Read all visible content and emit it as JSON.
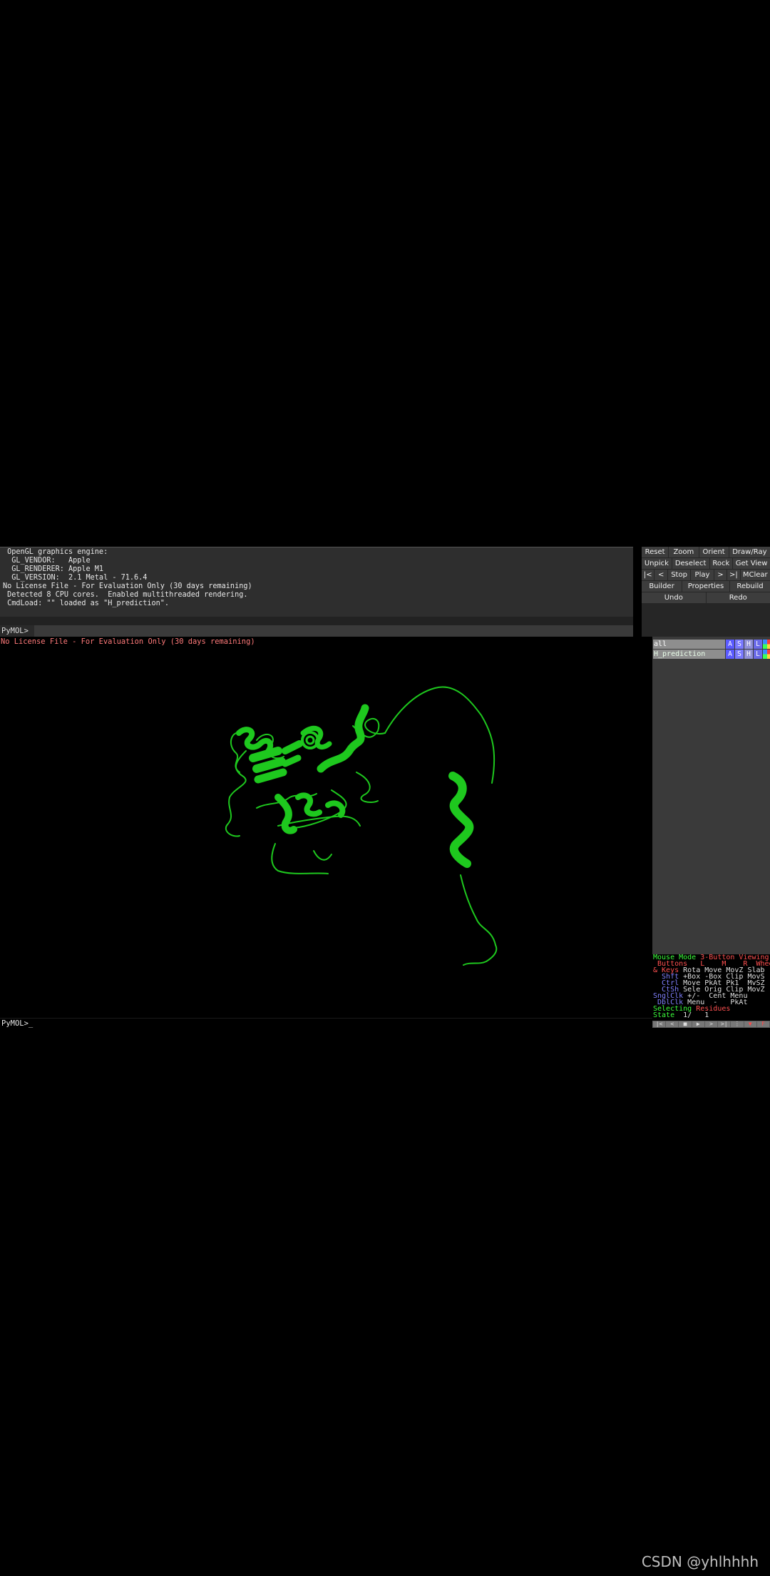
{
  "console": {
    "lines": [
      " OpenGL graphics engine:",
      "  GL_VENDOR:   Apple",
      "  GL_RENDERER: Apple M1",
      "  GL_VERSION:  2.1 Metal - 71.6.4",
      "No License File - For Evaluation Only (30 days remaining)",
      " Detected 8 CPU cores.  Enabled multithreaded rendering.",
      " CmdLoad: \"\" loaded as \"H_prediction\"."
    ],
    "prompt": "PyMOL>"
  },
  "buttons": {
    "row1": [
      "Reset",
      "Zoom",
      "Orient",
      "Draw/Ray"
    ],
    "row2": [
      "Unpick",
      "Deselect",
      "Rock",
      "Get View"
    ],
    "row3": [
      "|<",
      "<",
      "Stop",
      "Play",
      ">",
      ">|",
      "MClear"
    ],
    "row4": [
      "Builder",
      "Properties",
      "Rebuild"
    ],
    "row5": [
      "Undo",
      "Redo"
    ]
  },
  "viewer": {
    "license_warning": "No License File - For Evaluation Only (30 days remaining)",
    "molecule_color": "#1ec81e"
  },
  "objects": [
    {
      "name": "all",
      "buttons": [
        "A",
        "S",
        "H",
        "L"
      ]
    },
    {
      "name": "H_prediction",
      "buttons": [
        "A",
        "S",
        "H",
        "L"
      ]
    }
  ],
  "mouse_mode": {
    "title_label": "Mouse Mode",
    "title_value": "3-Button Viewing",
    "header": " Buttons   L    M    R  Wheel",
    "rows": [
      {
        "key": "& Keys",
        "values": " Rota Move MovZ Slab"
      },
      {
        "key": "  Shft",
        "values": " +Box -Box Clip MovS"
      },
      {
        "key": "  Ctrl",
        "values": " Move PkAt Pk1  MvSZ"
      },
      {
        "key": "  CtSh",
        "values": " Sele Orig Clip MovZ"
      },
      {
        "key": "SnglClk",
        "values": " +/-  Cent Menu"
      },
      {
        "key": " DblClk",
        "values": " Menu  -   PkAt"
      }
    ],
    "selecting_label": "Selecting",
    "selecting_value": "Residues",
    "state_label": "State",
    "state_value": "  1/   1"
  },
  "playback": [
    "|<",
    "<",
    "■",
    "▶",
    ">",
    ">|",
    "⋮",
    "▼",
    "F"
  ],
  "bottom_prompt": "PyMOL>_",
  "watermark": "CSDN @yhlhhhh"
}
